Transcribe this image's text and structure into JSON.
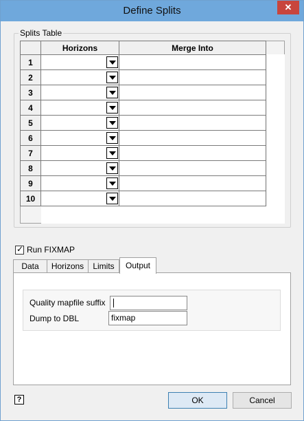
{
  "window": {
    "title": "Define Splits",
    "close_label": "✕"
  },
  "splits": {
    "legend": "Splits Table",
    "columns": [
      "Horizons",
      "Merge Into"
    ],
    "rows": [
      "1",
      "2",
      "3",
      "4",
      "5",
      "6",
      "7",
      "8",
      "9",
      "10"
    ]
  },
  "fixmap": {
    "label": "Run FIXMAP",
    "checked": true
  },
  "tabs": [
    "Data",
    "Horizons",
    "Limits",
    "Output"
  ],
  "active_tab": "Output",
  "output": {
    "suffix_label": "Quality mapfile suffix",
    "suffix_value": "",
    "dbl_label": "Dump to DBL",
    "dbl_value": "fixmap"
  },
  "buttons": {
    "ok": "OK",
    "cancel": "Cancel",
    "help": "?"
  }
}
